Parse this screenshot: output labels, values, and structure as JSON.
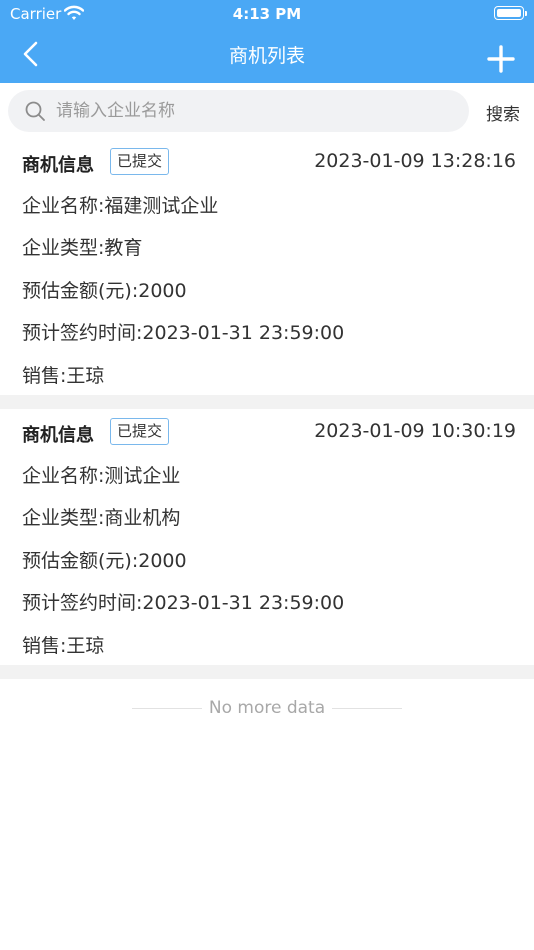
{
  "status_bar": {
    "carrier": "Carrier",
    "time": "4:13 PM"
  },
  "nav": {
    "title": "商机列表",
    "back_icon": "chevron-left-icon",
    "add_icon": "plus-icon"
  },
  "search": {
    "placeholder": "请输入企业名称",
    "value": "",
    "button_label": "搜索"
  },
  "items": [
    {
      "title": "商机信息",
      "badge": "已提交",
      "created_at": "2023-01-09 13:28:16",
      "company": "企业名称:福建测试企业",
      "type": "企业类型:教育",
      "amount": "预估金额(元):2000",
      "sign_time": "预计签约时间:2023-01-31 23:59:00",
      "sales": "销售:王琼"
    },
    {
      "title": "商机信息",
      "badge": "已提交",
      "created_at": "2023-01-09 10:30:19",
      "company": "企业名称:测试企业",
      "type": "企业类型:商业机构",
      "amount": "预估金额(元):2000",
      "sign_time": "预计签约时间:2023-01-31 23:59:00",
      "sales": "销售:王琼"
    }
  ],
  "footer": {
    "no_more": "No more data"
  },
  "colors": {
    "accent": "#4aa8f5",
    "badge_border": "#7ab8ec",
    "divider": "#f2f2f2"
  }
}
